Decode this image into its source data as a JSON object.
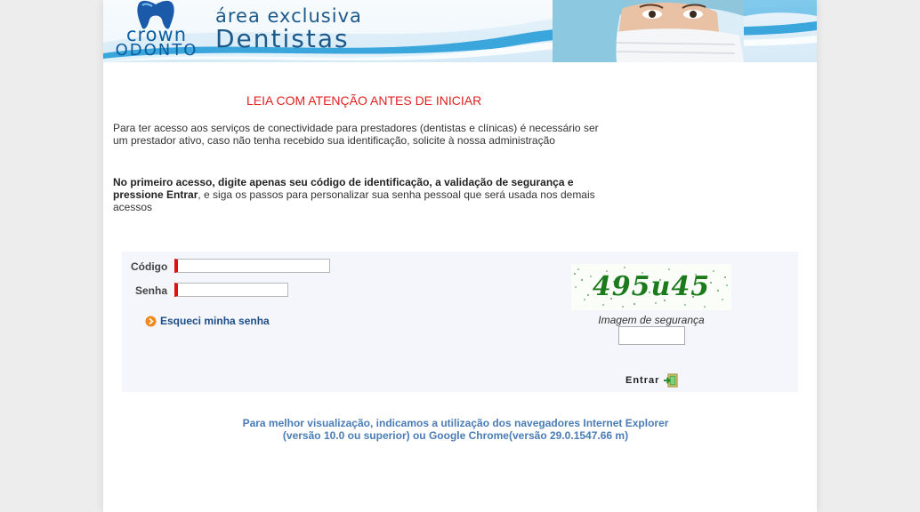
{
  "header": {
    "logo_line1": "crown",
    "logo_line2": "ODONTO",
    "title_line1": "área exclusiva",
    "title_line2": "Dentistas"
  },
  "notice": {
    "title": "LEIA COM ATENÇÃO ANTES DE INICIAR",
    "paragraph1": "Para ter acesso aos serviços de conectividade para prestadores (dentistas e clínicas) é necessário ser um prestador ativo, caso não tenha recebido sua identificação, solicite à nossa administração",
    "paragraph2_bold": "No primeiro acesso, digite apenas seu código de identificação, a validação de segurança e pressione Entrar",
    "paragraph2_rest": ", e siga os passos para personalizar sua senha pessoal que será usada nos demais acessos"
  },
  "login": {
    "code_label": "Código",
    "code_value": "",
    "password_label": "Senha",
    "password_value": "",
    "forgot_label": "Esqueci minha senha",
    "captcha_text": "495u45",
    "captcha_label": "Imagem de segurança",
    "captcha_value": "",
    "enter_label": "Entrar"
  },
  "footer": {
    "browser_note": "Para melhor visualização, indicamos a utilização dos navegadores Internet Explorer (versão 10.0 ou superior) ou Google Chrome(versão 29.0.1547.66 m)"
  },
  "colors": {
    "warning": "#e02020",
    "brand_blue": "#0d5c9e",
    "link_blue": "#1d4d86",
    "note_blue": "#4a7cb5",
    "required_marker": "#e01010"
  }
}
